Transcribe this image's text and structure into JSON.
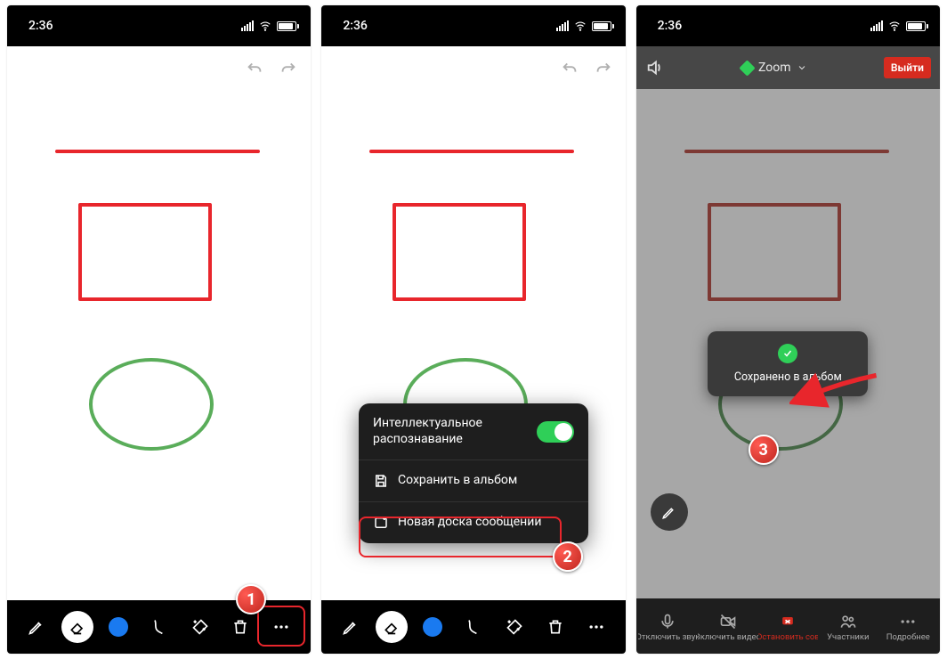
{
  "status": {
    "time": "2:36"
  },
  "popup": {
    "smart_recognition": "Интеллектуальное распознавание",
    "save_to_album": "Сохранить в альбом",
    "new_whiteboard": "Новая доска сообщений"
  },
  "toast": {
    "saved": "Сохранено в альбом"
  },
  "p3_header": {
    "title": "Zoom",
    "exit": "Выйти"
  },
  "p3_nav": {
    "mute": "Отключить звук",
    "video": "Включить видео",
    "stop": "Остановить сов",
    "participants": "Участники",
    "more": "Подробнее"
  },
  "steps": {
    "s1": "1",
    "s2": "2",
    "s3": "3"
  }
}
